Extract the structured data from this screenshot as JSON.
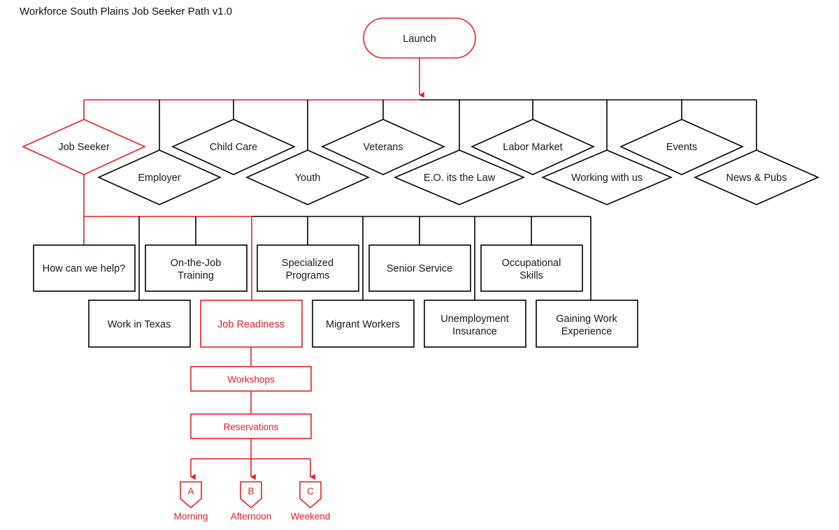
{
  "title": "Workforce South Plains Job Seeker Path  v1.0",
  "colors": {
    "accent_red": "#ee1d23",
    "line_black": "#000000",
    "background": "#ffffff"
  },
  "start_node": {
    "label": "Launch",
    "shape": "stadium",
    "outline": "#ee1d23"
  },
  "categories": [
    {
      "label": "Job Seeker",
      "row": "upper",
      "highlighted": true
    },
    {
      "label": "Employer",
      "row": "lower",
      "highlighted": false
    },
    {
      "label": "Child Care",
      "row": "upper",
      "highlighted": false
    },
    {
      "label": "Youth",
      "row": "lower",
      "highlighted": false
    },
    {
      "label": "Veterans",
      "row": "upper",
      "highlighted": false
    },
    {
      "label": "E.O. its the Law",
      "row": "lower",
      "highlighted": false
    },
    {
      "label": "Labor Market",
      "row": "upper",
      "highlighted": false
    },
    {
      "label": "Working with us",
      "row": "lower",
      "highlighted": false
    },
    {
      "label": "Events",
      "row": "upper",
      "highlighted": false
    },
    {
      "label": "News & Pubs",
      "row": "lower",
      "highlighted": false
    }
  ],
  "services": [
    {
      "label": "How can we help?",
      "row": "upper",
      "highlighted": false
    },
    {
      "label": "Work in Texas",
      "row": "lower",
      "highlighted": false
    },
    {
      "label": "On-the-Job\nTraining",
      "row": "upper",
      "highlighted": false
    },
    {
      "label": "Job Readiness",
      "row": "lower",
      "highlighted": true
    },
    {
      "label": "Specialized\nPrograms",
      "row": "upper",
      "highlighted": false
    },
    {
      "label": "Migrant Workers",
      "row": "lower",
      "highlighted": false
    },
    {
      "label": "Senior Service",
      "row": "upper",
      "highlighted": false
    },
    {
      "label": "Unemployment\nInsurance",
      "row": "lower",
      "highlighted": false
    },
    {
      "label": "Occupational\nSkills",
      "row": "upper",
      "highlighted": false
    },
    {
      "label": "Gaining Work\nExperience",
      "row": "lower",
      "highlighted": false
    }
  ],
  "flow_chain": [
    {
      "label": "Workshops"
    },
    {
      "label": "Reservations"
    }
  ],
  "terminals": [
    {
      "tag": "A",
      "label": "Morning"
    },
    {
      "tag": "B",
      "label": "Afternoon"
    },
    {
      "tag": "C",
      "label": "Weekend"
    }
  ]
}
